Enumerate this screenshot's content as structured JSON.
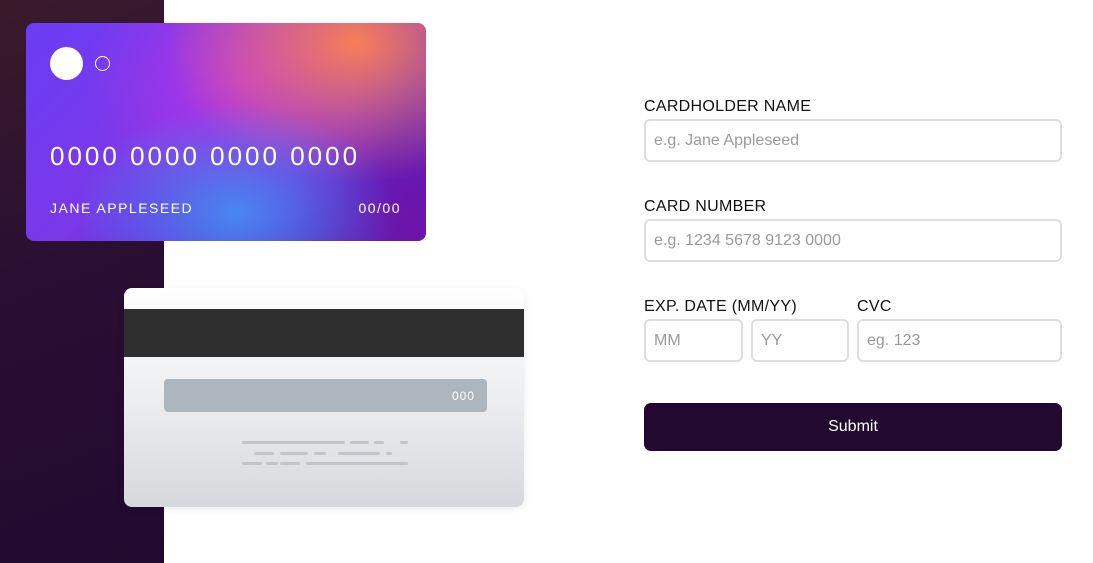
{
  "card_front": {
    "number": "0000 0000 0000 0000",
    "holder_name": "JANE APPLESEED",
    "expiry": "00/00"
  },
  "card_back": {
    "cvc": "000"
  },
  "form": {
    "cardholder_name": {
      "label": "CARDHOLDER NAME",
      "placeholder": "e.g. Jane Appleseed",
      "value": ""
    },
    "card_number": {
      "label": "CARD NUMBER",
      "placeholder": "e.g. 1234 5678 9123 0000",
      "value": ""
    },
    "exp_date": {
      "label": "EXP. DATE (MM/YY)",
      "month_placeholder": "MM",
      "year_placeholder": "YY"
    },
    "cvc": {
      "label": "CVC",
      "placeholder": "eg. 123",
      "value": ""
    },
    "submit_label": "Submit"
  },
  "colors": {
    "sidebar": "#21092f",
    "button": "#21092f",
    "input_border": "#dedede"
  }
}
